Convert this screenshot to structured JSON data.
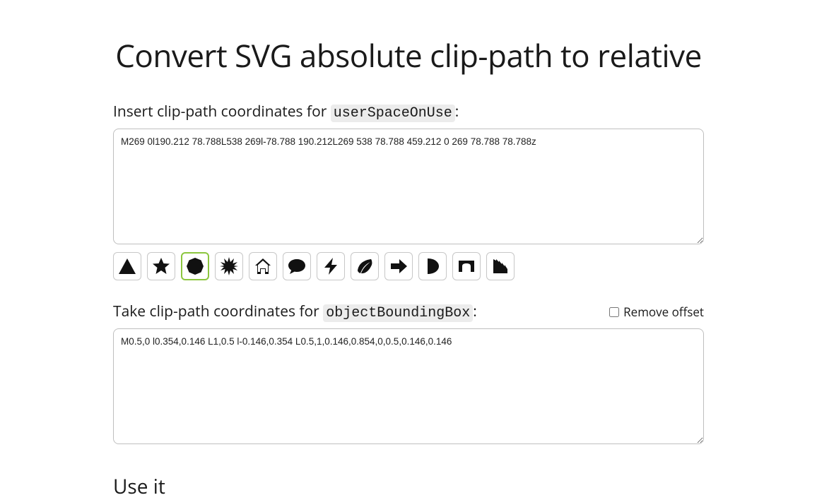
{
  "title": "Convert SVG absolute clip-path to relative",
  "input": {
    "label_prefix": "Insert clip-path coordinates for ",
    "pill": "userSpaceOnUse",
    "label_suffix": ":",
    "value": "M269 0l190.212 78.788L538 269l-78.788 190.212L269 538 78.788 459.212 0 269 78.788 78.788z"
  },
  "shapes": {
    "triangle": "triangle",
    "star": "star",
    "octagon": "octagon",
    "burst": "burst",
    "house": "house",
    "chat": "chat",
    "bolt": "bolt",
    "leaf": "leaf",
    "arrow": "arrow",
    "halfcircle": "halfcircle",
    "bridge": "bridge",
    "saw": "saw"
  },
  "output": {
    "label_prefix": "Take clip-path coordinates for ",
    "pill": "objectBoundingBox",
    "label_suffix": ":",
    "value": "M0.5,0 l0.354,0.146 L1,0.5 l-0.146,0.354 L0.5,1,0.146,0.854,0,0.5,0.146,0.146"
  },
  "remove_offset": {
    "label": "Remove offset",
    "checked": false
  },
  "bottom_heading": "Use it"
}
